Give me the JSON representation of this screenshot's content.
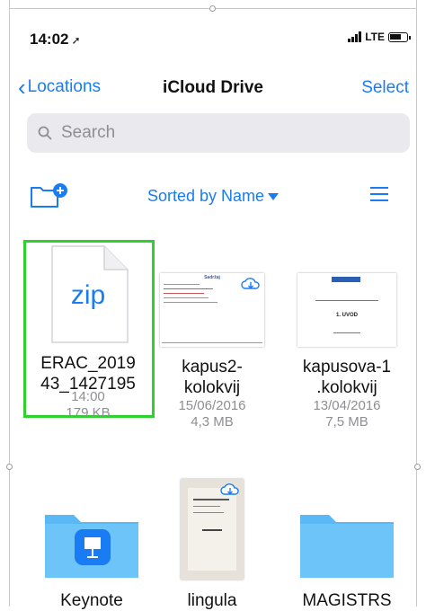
{
  "status_bar": {
    "time": "14:02",
    "carrier": "LTE"
  },
  "nav": {
    "back_label": "Locations",
    "title": "iCloud Drive",
    "select_label": "Select"
  },
  "search": {
    "placeholder": "Search"
  },
  "toolbar": {
    "sort_label": "Sorted by Name"
  },
  "files": [
    {
      "name_line1": "ERAC_2019",
      "name_line2": "43_1427195",
      "meta1": "14:00",
      "meta2": "179 KB",
      "badge": "zip"
    },
    {
      "name_line1": "kapus2-",
      "name_line2": "kolokvij",
      "meta1": "15/06/2016",
      "meta2": "4,3 MB"
    },
    {
      "name_line1": "kapusova-1",
      "name_line2": ".kolokvij",
      "meta1": "13/04/2016",
      "meta2": "7,5 MB"
    }
  ],
  "row2": [
    {
      "name": "Keynote"
    },
    {
      "name": "lingula"
    },
    {
      "name": "MAGISTRS"
    }
  ],
  "thumb_text": {
    "kapus_title": "Sadržaj",
    "kapus_doc_heading": "1. UVOD"
  },
  "colors": {
    "accent": "#1a7cf2",
    "selection": "#2ed12e",
    "folder": "#5ab8f5"
  }
}
